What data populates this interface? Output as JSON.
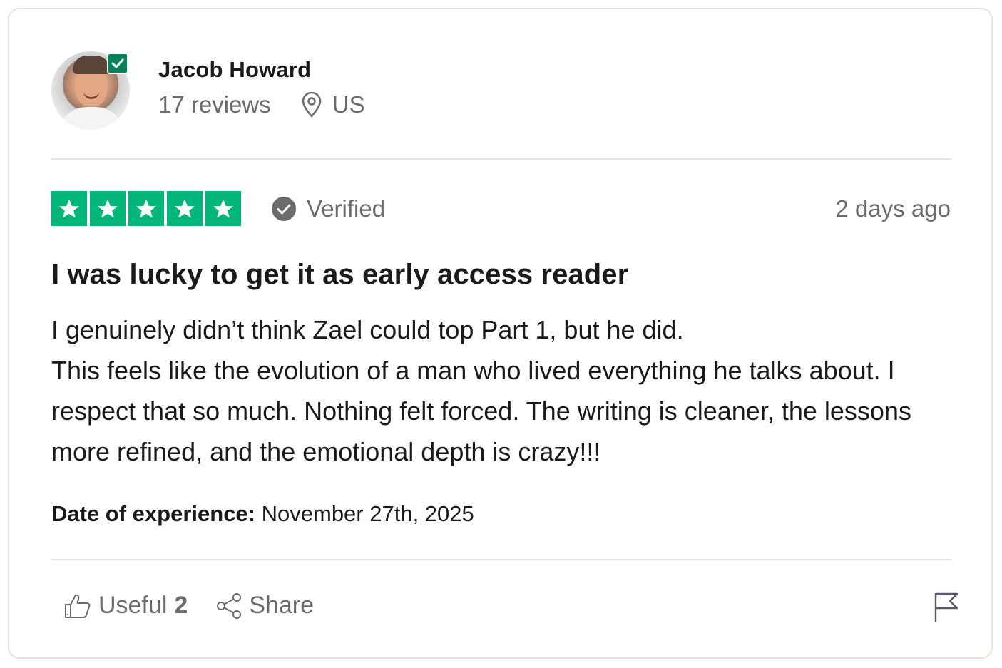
{
  "reviewer": {
    "name": "Jacob Howard",
    "reviews": "17 reviews",
    "location": "US",
    "avatar_icon": "user-photo",
    "badge_icon": "verified-check-icon"
  },
  "review": {
    "rating": 5,
    "rating_max": 5,
    "verified_label": "Verified",
    "posted": "2 days ago",
    "title": "I was lucky to get it as early access reader",
    "body_line_1": "I genuinely didn’t think Zael could top Part 1, but he did.",
    "body_line_2": "This feels like the evolution of a man who lived everything he talks about. I respect that so much. Nothing felt forced. The writing is cleaner, the lessons more refined, and the emotional depth is crazy!!!",
    "experience_label": "Date of experience:",
    "experience_date": "November 27th, 2025"
  },
  "actions": {
    "useful_label": "Useful",
    "useful_count": "2",
    "share_label": "Share",
    "flag_icon": "flag-icon"
  },
  "colors": {
    "star_green": "#00b67a",
    "badge_green": "#04825a",
    "text_dark": "#1a1a1a",
    "text_muted": "#6b6b6b",
    "border": "#e5e5dd"
  }
}
